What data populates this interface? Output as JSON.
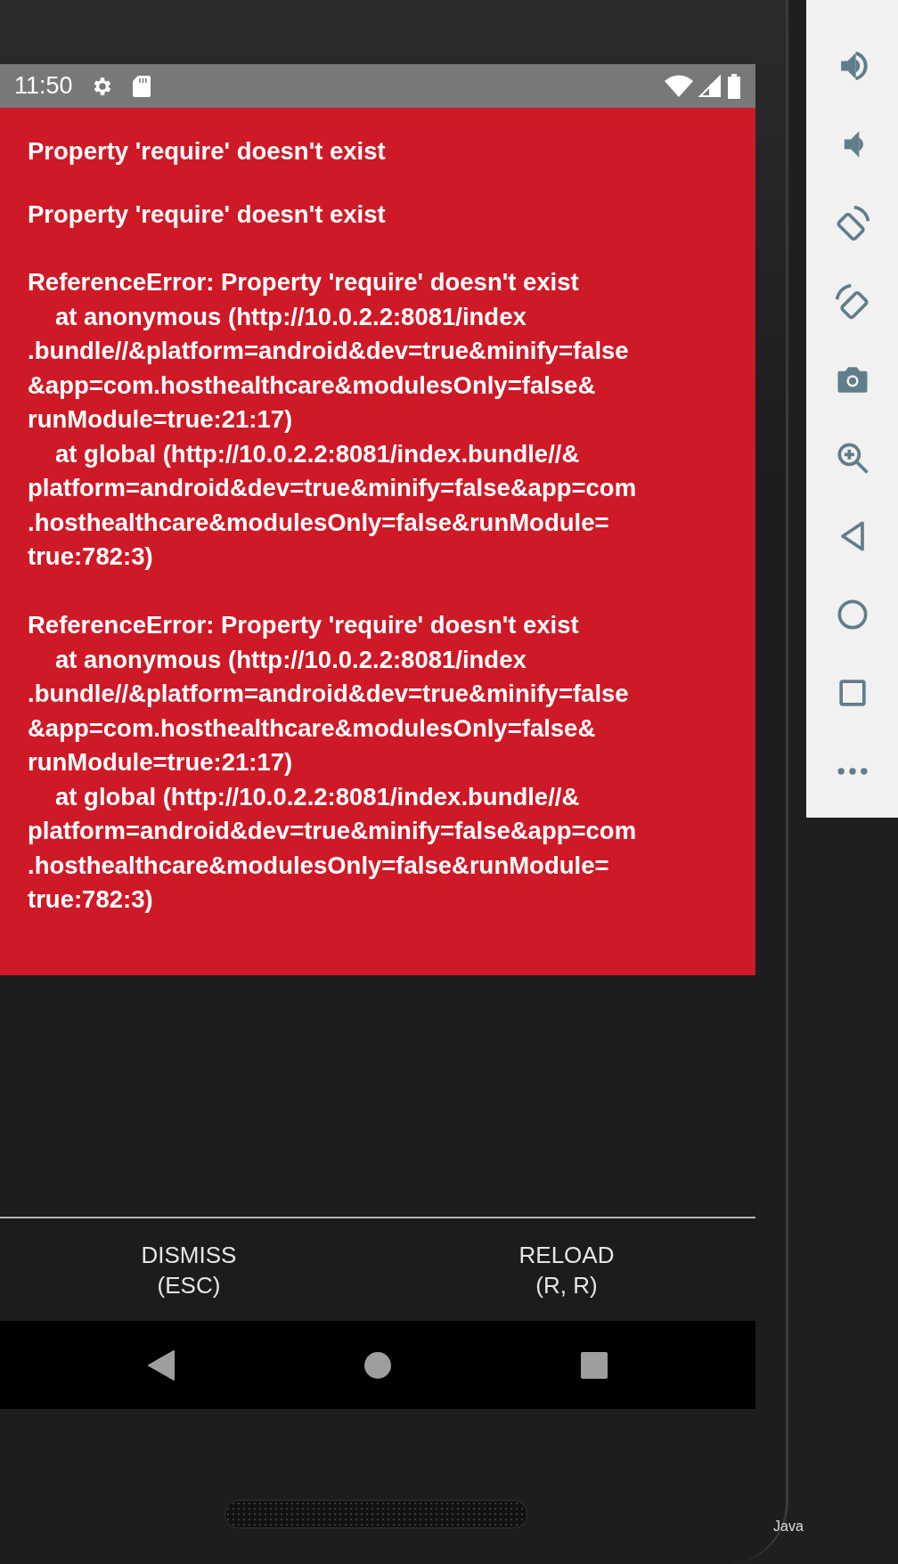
{
  "status_bar": {
    "time": "11:50"
  },
  "error": {
    "messages": [
      {
        "kind": "plain",
        "text": "Property 'require' doesn't exist"
      },
      {
        "kind": "plain",
        "text": "Property 'require' doesn't exist"
      },
      {
        "kind": "stack",
        "text": "ReferenceError: Property 'require' doesn't exist",
        "frames": [
          {
            "lines": [
              "at anonymous (http://10.0.2.2:8081/index",
              ".bundle//&platform=android&dev=true&minify=false",
              "&app=com.hosthealthcare&modulesOnly=false&",
              "runModule=true:21:17)"
            ]
          },
          {
            "lines": [
              "at global (http://10.0.2.2:8081/index.bundle//&",
              "platform=android&dev=true&minify=false&app=com",
              ".hosthealthcare&modulesOnly=false&runModule=",
              "true:782:3)"
            ]
          }
        ]
      },
      {
        "kind": "stack",
        "text": "ReferenceError: Property 'require' doesn't exist",
        "frames": [
          {
            "lines": [
              "at anonymous (http://10.0.2.2:8081/index",
              ".bundle//&platform=android&dev=true&minify=false",
              "&app=com.hosthealthcare&modulesOnly=false&",
              "runModule=true:21:17)"
            ]
          },
          {
            "lines": [
              "at global (http://10.0.2.2:8081/index.bundle//&",
              "platform=android&dev=true&minify=false&app=com",
              ".hosthealthcare&modulesOnly=false&runModule=",
              "true:782:3)"
            ]
          }
        ]
      }
    ]
  },
  "buttons": [
    {
      "label": "DISMISS",
      "shortcut": "(ESC)"
    },
    {
      "label": "RELOAD",
      "shortcut": "(R, R)"
    }
  ],
  "background_label": "Java"
}
